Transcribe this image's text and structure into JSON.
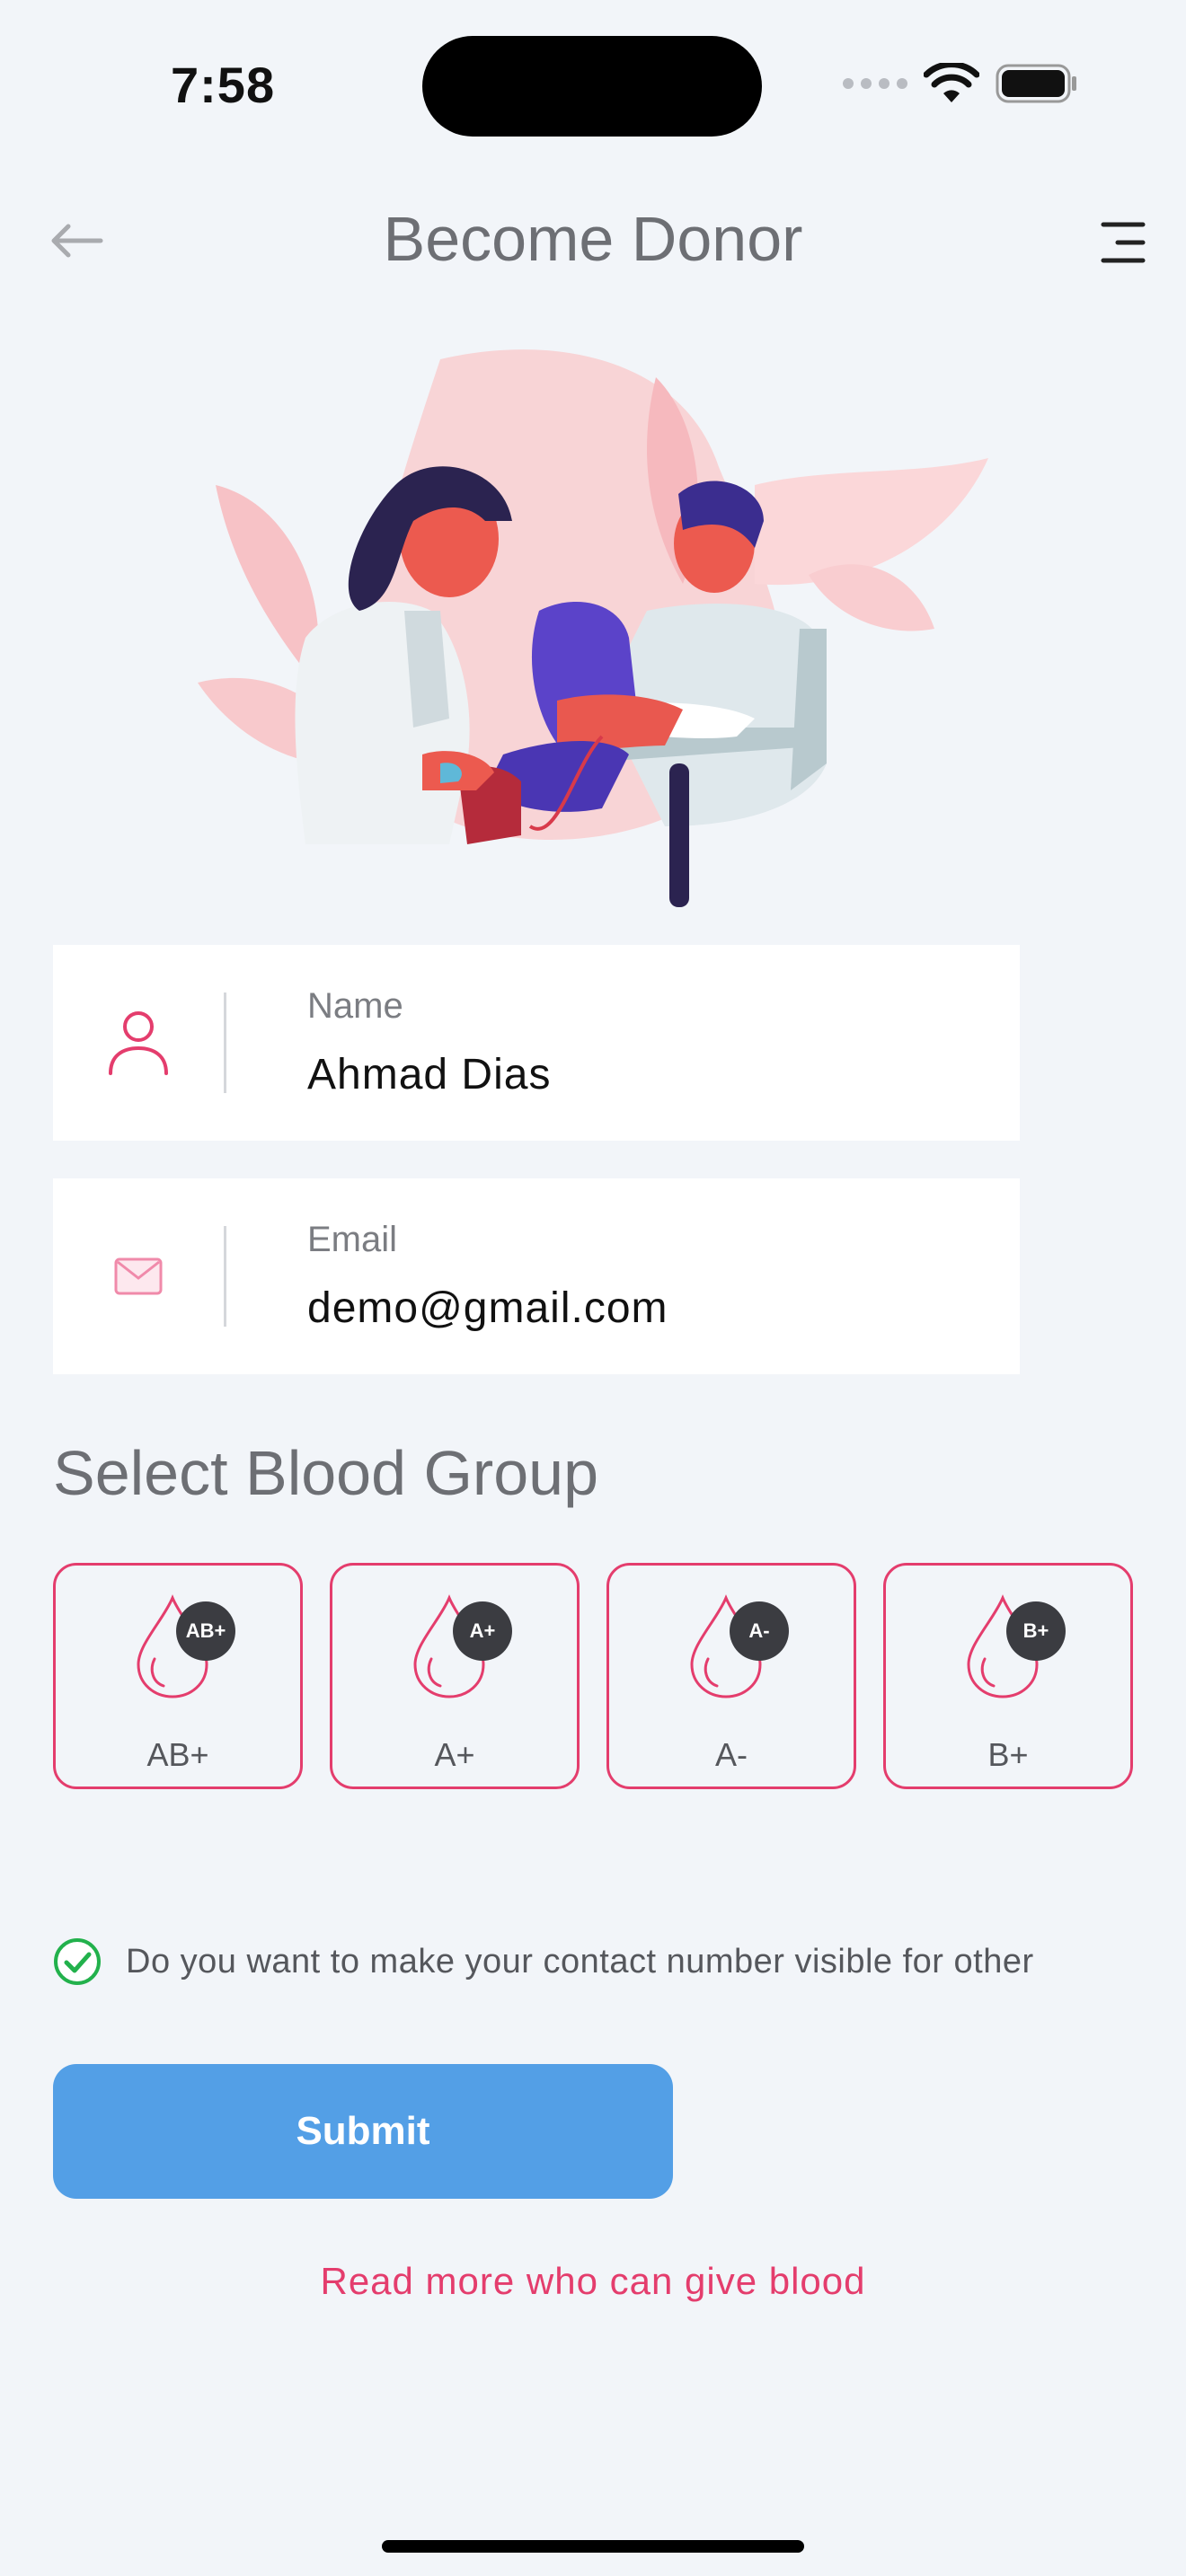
{
  "status_bar": {
    "time": "7:58"
  },
  "header": {
    "title": "Become Donor",
    "back_icon": "arrow-left-icon",
    "menu_icon": "menu-icon"
  },
  "form": {
    "name": {
      "label": "Name",
      "value": "Ahmad Dias",
      "icon": "user-icon"
    },
    "email": {
      "label": "Email",
      "value": "demo@gmail.com",
      "icon": "mail-icon"
    }
  },
  "blood_section": {
    "title": "Select Blood Group",
    "groups": [
      {
        "badge": "AB+",
        "label": "AB+"
      },
      {
        "badge": "A+",
        "label": "A+"
      },
      {
        "badge": "A-",
        "label": "A-"
      },
      {
        "badge": "B+",
        "label": "B+"
      }
    ]
  },
  "contact_visibility": {
    "checked": true,
    "label": "Do you want to make your contact number visible for other"
  },
  "submit_label": "Submit",
  "read_more": "Read more who can give blood",
  "colors": {
    "accent": "#e43d6d",
    "button": "#539fe6",
    "background": "#f2f5f9"
  }
}
